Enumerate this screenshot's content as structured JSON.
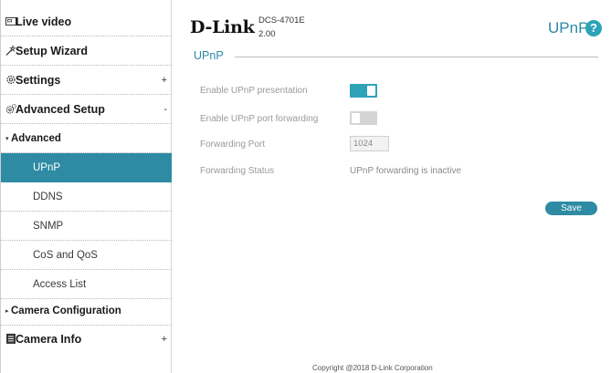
{
  "sidebar": {
    "items": [
      {
        "label": "Live video",
        "icon": "video-icon"
      },
      {
        "label": "Setup Wizard",
        "icon": "wizard-icon"
      },
      {
        "label": "Settings",
        "icon": "gear-icon",
        "toggle": "+"
      },
      {
        "label": "Advanced Setup",
        "icon": "gears-icon",
        "toggle": "-"
      },
      {
        "label": "Advanced",
        "marker": "▾"
      },
      {
        "label": "UPnP",
        "active": true
      },
      {
        "label": "DDNS"
      },
      {
        "label": "SNMP"
      },
      {
        "label": "CoS and QoS"
      },
      {
        "label": "Access List"
      },
      {
        "label": "Camera Configuration",
        "marker": "▸"
      },
      {
        "label": "Camera Info",
        "icon": "document-icon",
        "toggle": "+"
      }
    ]
  },
  "header": {
    "logo": "D-Link",
    "model": "DCS-4701E",
    "firmware": "2.00",
    "page_title": "UPnP",
    "help_symbol": "?"
  },
  "section": {
    "title": "UPnP"
  },
  "form": {
    "upnp_presentation": {
      "label": "Enable UPnP presentation",
      "enabled": true
    },
    "upnp_port_forwarding": {
      "label": "Enable UPnP port forwarding",
      "enabled": false
    },
    "forwarding_port": {
      "label": "Forwarding Port",
      "value": "1024"
    },
    "forwarding_status": {
      "label": "Forwarding Status",
      "value": "UPnP forwarding is inactive"
    }
  },
  "buttons": {
    "save": "Save"
  },
  "footer": {
    "copyright": "Copyright @2018 D-Link Corporation"
  },
  "colors": {
    "accent": "#2e8ba3",
    "toggle_on": "#2ea3b8",
    "toggle_off": "#d4d4d4"
  }
}
